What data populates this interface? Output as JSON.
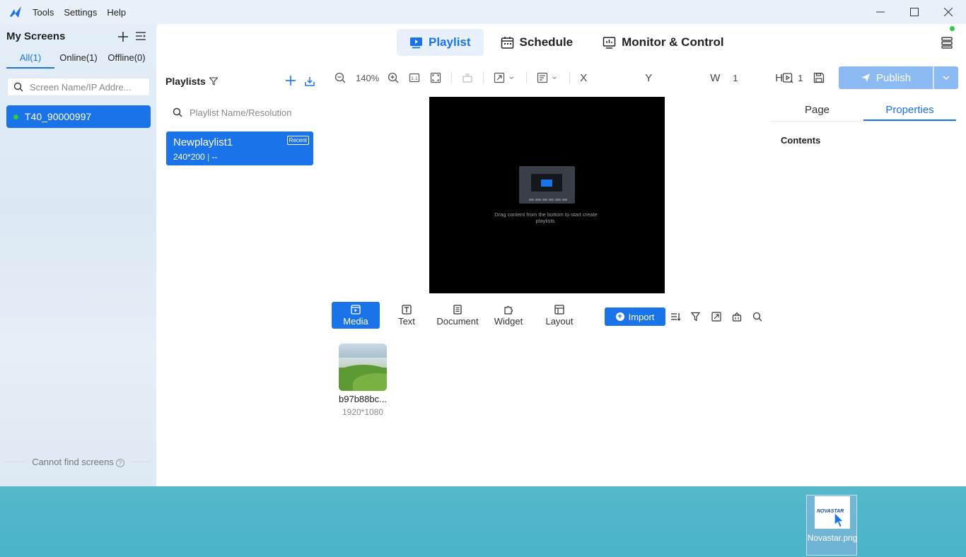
{
  "menu": {
    "tools": "Tools",
    "settings": "Settings",
    "help": "Help"
  },
  "window_controls": {
    "minimize": "—",
    "maximize": "☐",
    "close": "✕"
  },
  "sidebar": {
    "title": "My Screens",
    "tabs": {
      "all": "All(1)",
      "online": "Online(1)",
      "offline": "Offline(0)"
    },
    "search_placeholder": "Screen Name/IP Addre...",
    "screens": [
      {
        "name": "T40_90000997",
        "status": "online"
      }
    ],
    "footer": "Cannot find screens"
  },
  "nav": {
    "playlist": "Playlist",
    "schedule": "Schedule",
    "monitor": "Monitor & Control"
  },
  "playlists": {
    "title": "Playlists",
    "search_placeholder": "Playlist Name/Resolution",
    "items": [
      {
        "name": "Newplaylist1",
        "resolution": "240*200",
        "extra": "--",
        "badge": "Recent"
      }
    ]
  },
  "toolbar": {
    "zoom": "140%",
    "x_label": "X",
    "x_value": "",
    "y_label": "Y",
    "y_value": "",
    "w_label": "W",
    "w_value": "1",
    "h_label": "H",
    "h_value": "1"
  },
  "publish": {
    "label": "Publish"
  },
  "properties": {
    "tabs": {
      "page": "Page",
      "properties": "Properties"
    },
    "contents_label": "Contents"
  },
  "canvas": {
    "placeholder_text": "Drag content from the bottom to start create playlists."
  },
  "content_tabs": {
    "media": "Media",
    "text": "Text",
    "document": "Document",
    "widget": "Widget",
    "layout": "Layout"
  },
  "import": {
    "label": "Import"
  },
  "media_items": [
    {
      "name": "b97b88bc...",
      "resolution": "1920*1080"
    }
  ],
  "desktop": {
    "file_label": "Novastar.png",
    "logo_text": "NOVASTAR"
  },
  "colors": {
    "accent": "#1a73e8",
    "online": "#2ecc40",
    "publish_disabled": "#8cbaf3"
  }
}
